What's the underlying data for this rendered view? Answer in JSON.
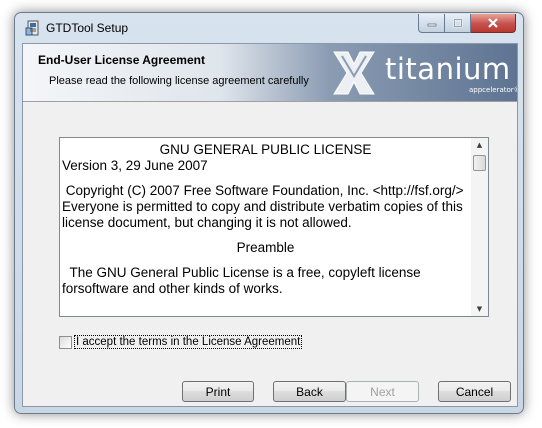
{
  "window": {
    "title": "GTDTool Setup"
  },
  "banner": {
    "heading": "End-User License Agreement",
    "subheading": "Please read the following license agreement carefully",
    "logo_word": "titanium",
    "logo_tagline": "appcelerator®"
  },
  "license": {
    "lines": [
      "GNU GENERAL PUBLIC LICENSE",
      "Version 3, 29 June 2007",
      " Copyright (C) 2007 Free Software Foundation, Inc. <http://fsf.org/> Everyone is permitted to copy and distribute verbatim copies of this license document, but changing it is not allowed.",
      "Preamble",
      "  The GNU General Public License is a free, copyleft license forsoftware and other kinds of works."
    ]
  },
  "accept": {
    "label": "I accept the terms in the License Agreement",
    "checked": false
  },
  "buttons": {
    "print": "Print",
    "back": "Back",
    "next": "Next",
    "cancel": "Cancel"
  },
  "colors": {
    "accent_banner": "#5e7492",
    "close_button": "#c75050"
  }
}
